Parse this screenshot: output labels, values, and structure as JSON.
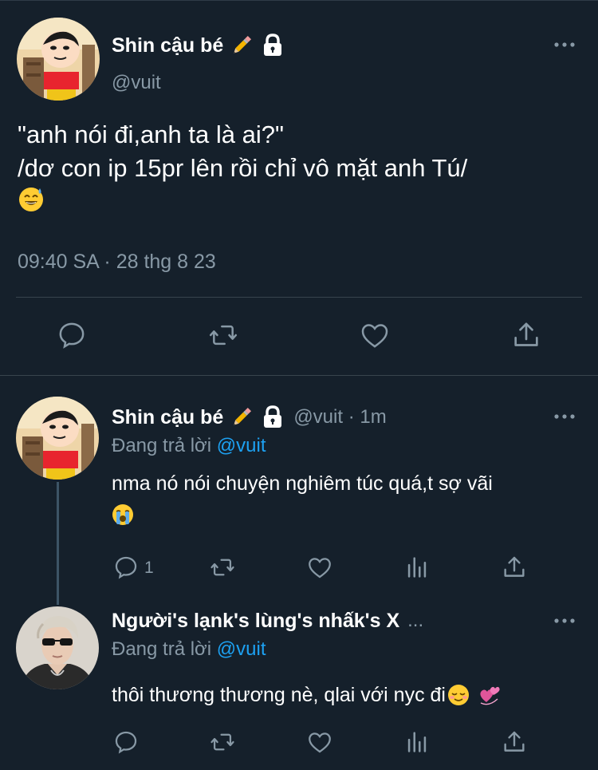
{
  "main_tweet": {
    "author_name": "Shin cậu bé",
    "handle": "@vuit",
    "text_lines": [
      "\"anh nói đi,anh ta là ai?\"",
      "/dơ con ip 15pr lên rồi chỉ vô mặt anh Tú/"
    ],
    "emoji": "😅",
    "timestamp": "09:40 SA · 28 thg 8 23",
    "actions": [
      "reply-icon",
      "retweet-icon",
      "like-icon",
      "share-icon"
    ]
  },
  "replies": [
    {
      "author_name": "Shin cậu bé",
      "handle_time": "@vuit · 1m",
      "replying_to_prefix": "Đang trả lời",
      "replying_to_handle": "@vuit",
      "text": "nma nó nói chuyện nghiêm túc quá,t sợ vãi",
      "emoji": "😭",
      "reply_count": "1",
      "actions": [
        "reply-icon",
        "retweet-icon",
        "like-icon",
        "analytics-icon",
        "share-icon"
      ]
    },
    {
      "author_name": "Người's lạnk's lùng's nhấk's X",
      "name_ellipsis": "...",
      "replying_to_prefix": "Đang trả lời",
      "replying_to_handle": "@vuit",
      "text": "thôi thương thương nè, qlai với nyc đi",
      "emoji": "☺️ 💞",
      "actions": [
        "reply-icon",
        "retweet-icon",
        "like-icon",
        "analytics-icon",
        "share-icon"
      ]
    }
  ],
  "colors": {
    "background": "#15202b",
    "secondary_text": "#8899a6",
    "link": "#1da1f2",
    "separator": "#38444d"
  }
}
